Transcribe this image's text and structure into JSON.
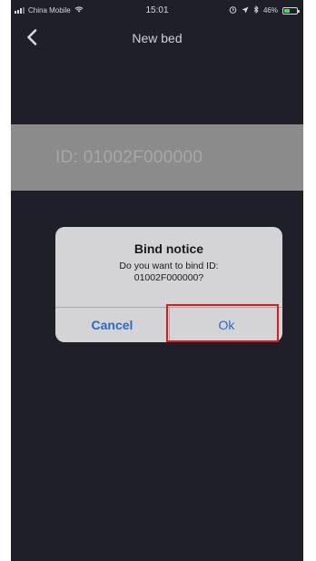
{
  "status_bar": {
    "carrier": "China Mobile",
    "time": "15:01",
    "battery": "46%",
    "icons": [
      "signal-icon",
      "wifi-icon",
      "alarm-icon",
      "location-icon",
      "bluetooth-icon",
      "battery-icon"
    ]
  },
  "navbar": {
    "title": "New bed",
    "back_icon": "chevron-left-icon"
  },
  "id_bar": {
    "text": "ID: 01002F000000"
  },
  "dialog": {
    "title": "Bind notice",
    "message_line1": "Do you want to bind ID:",
    "message_line2": "01002F000000?",
    "cancel_label": "Cancel",
    "ok_label": "Ok"
  },
  "colors": {
    "background": "#1e1f28",
    "id_bar": "#8b8b8b",
    "dialog_bg": "#d4d4d6",
    "button_text": "#2a69c9",
    "highlight": "#e0191d",
    "battery_fill": "#4cd964"
  }
}
